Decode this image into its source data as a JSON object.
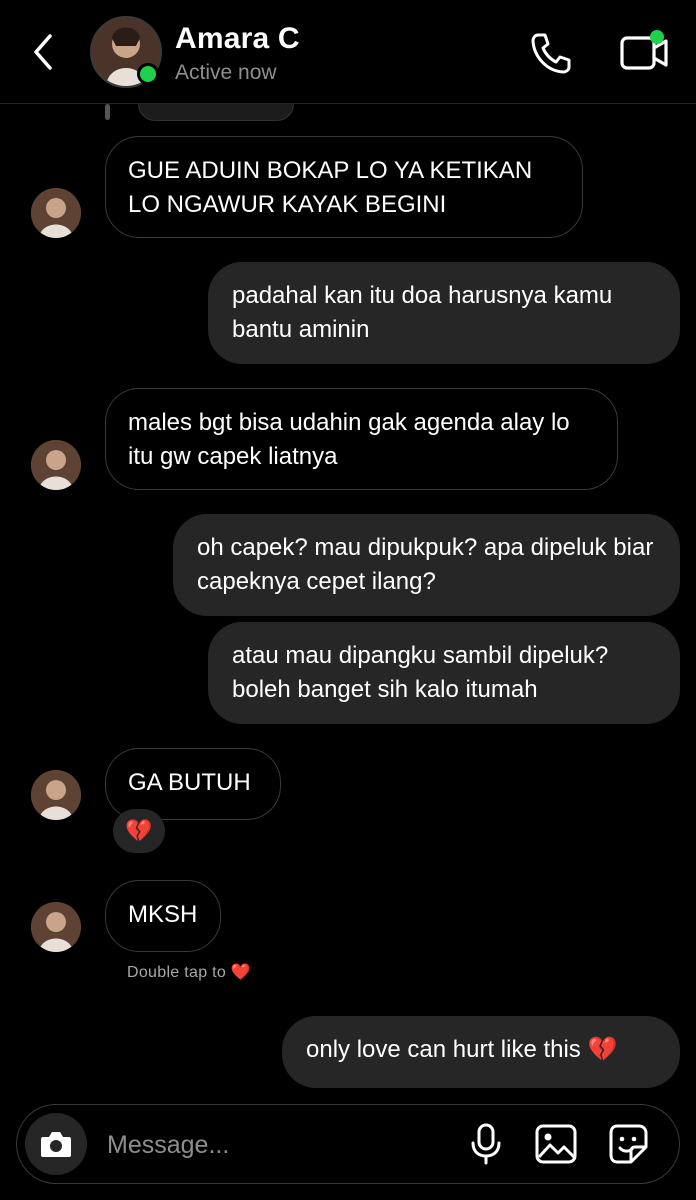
{
  "header": {
    "contact_name": "Amara C",
    "status": "Active now",
    "back_icon": "chevron-left-icon",
    "call_icon": "phone-icon",
    "video_icon": "video-camera-icon",
    "online_color": "#1ed04b"
  },
  "messages": [
    {
      "side": "in",
      "text": "GUE ADUIN BOKAP LO YA KETIKAN LO NGAWUR KAYAK BEGINI"
    },
    {
      "side": "out",
      "text": "padahal kan itu doa harusnya kamu bantu aminin"
    },
    {
      "side": "in",
      "text": "males bgt bisa udahin gak agenda alay lo itu gw capek liatnya"
    },
    {
      "side": "out",
      "text": "oh capek? mau dipukpuk? apa dipeluk biar capeknya cepet ilang?"
    },
    {
      "side": "out",
      "text": "atau mau dipangku sambil dipeluk? boleh banget sih kalo itumah"
    },
    {
      "side": "in",
      "text": "GA BUTUH",
      "reaction": "💔"
    },
    {
      "side": "in",
      "text": "MKSH",
      "hint": "Double tap to",
      "hint_icon": "❤️"
    },
    {
      "side": "out",
      "text": "only love can hurt like this 💔"
    }
  ],
  "composer": {
    "placeholder": "Message...",
    "camera_icon": "camera-icon",
    "mic_icon": "microphone-icon",
    "gallery_icon": "image-icon",
    "sticker_icon": "sticker-icon"
  },
  "colors": {
    "background": "#000000",
    "outgoing_bubble": "#262626",
    "incoming_border": "#3a3a3a",
    "muted_text": "#8e8e8e"
  }
}
